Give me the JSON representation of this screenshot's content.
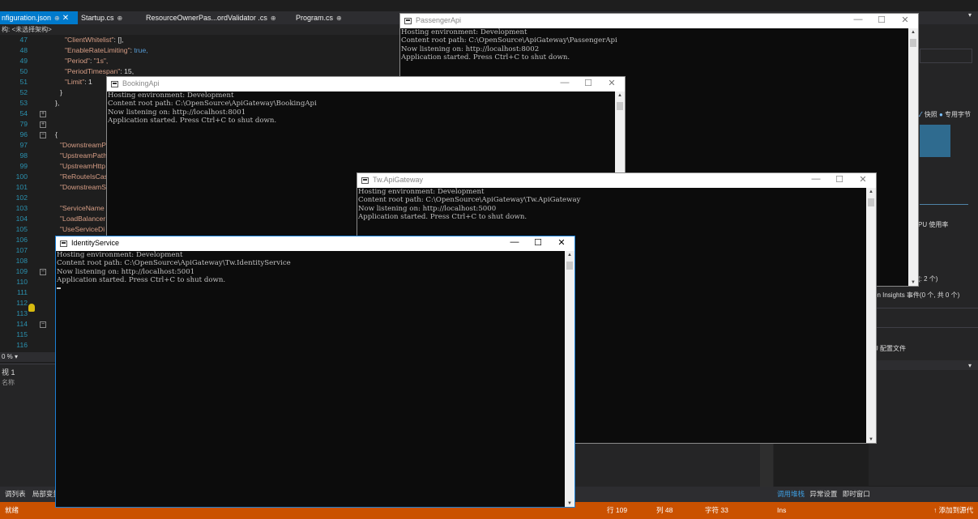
{
  "vs": {
    "tabs": [
      {
        "label": "nfiguration.json",
        "pin": "⊕",
        "close": "✕"
      },
      {
        "label": "Startup.cs",
        "pin": "⊕"
      },
      {
        "label": "ResourceOwnerPas...ordValidator .cs",
        "pin": "⊕"
      },
      {
        "label": "Program.cs",
        "pin": "⊕"
      }
    ],
    "tab_dropdown": "▾",
    "navbar": "构: <未选择架构>",
    "code_lines": [
      {
        "ln": "47",
        "key": "\"ClientWhitelist\"",
        "sep": ": ",
        "val": "[],",
        "vcls": "plain"
      },
      {
        "ln": "48",
        "key": "\"EnableRateLimiting\"",
        "sep": ": ",
        "val": "true,",
        "vcls": "v"
      },
      {
        "ln": "49",
        "key": "\"Period\"",
        "sep": ": ",
        "val": "\"1s\",",
        "vcls": "k"
      },
      {
        "ln": "50",
        "key": "\"PeriodTimespan\"",
        "sep": ": ",
        "val": "15,",
        "vcls": "plain"
      },
      {
        "ln": "51",
        "key": "\"Limit\"",
        "sep": ": ",
        "val": "1",
        "vcls": "plain"
      },
      {
        "ln": "52",
        "key": "",
        "sep": "",
        "val": "}",
        "vcls": "plain"
      },
      {
        "ln": "53",
        "key": "",
        "sep": "",
        "val": "},",
        "vcls": "plain"
      },
      {
        "ln": "54",
        "key": "",
        "sep": "",
        "val": "",
        "vcls": "plain"
      },
      {
        "ln": "79",
        "key": "",
        "sep": "",
        "val": "",
        "vcls": "plain"
      },
      {
        "ln": "96",
        "key": "",
        "sep": "",
        "val": "{",
        "vcls": "plain"
      },
      {
        "ln": "97",
        "key": "\"DownstreamP",
        "sep": "",
        "val": "",
        "vcls": "plain"
      },
      {
        "ln": "98",
        "key": "\"UpstreamPath",
        "sep": "",
        "val": "",
        "vcls": "plain"
      },
      {
        "ln": "99",
        "key": "\"UpstreamHttp",
        "sep": "",
        "val": "",
        "vcls": "plain"
      },
      {
        "ln": "100",
        "key": "\"ReRouteIsCas",
        "sep": "",
        "val": "",
        "vcls": "plain"
      },
      {
        "ln": "101",
        "key": "\"DownstreamS",
        "sep": "",
        "val": "",
        "vcls": "plain"
      },
      {
        "ln": "102",
        "key": "",
        "sep": "",
        "val": "",
        "vcls": "plain"
      },
      {
        "ln": "103",
        "key": "\"ServiceName",
        "sep": "",
        "val": "",
        "vcls": "plain"
      },
      {
        "ln": "104",
        "key": "\"LoadBalancer",
        "sep": "",
        "val": "",
        "vcls": "plain"
      },
      {
        "ln": "105",
        "key": "\"UseServiceDi",
        "sep": "",
        "val": "",
        "vcls": "plain"
      },
      {
        "ln": "106",
        "key": "",
        "sep": "",
        "val": "",
        "vcls": "plain"
      },
      {
        "ln": "107",
        "key": "",
        "sep": "",
        "val": "",
        "vcls": "plain"
      },
      {
        "ln": "108",
        "key": "",
        "sep": "",
        "val": "",
        "vcls": "plain"
      },
      {
        "ln": "109",
        "key": "",
        "sep": "",
        "val": "",
        "vcls": "plain"
      },
      {
        "ln": "110",
        "key": "",
        "sep": "",
        "val": "",
        "vcls": "plain"
      },
      {
        "ln": "111",
        "key": "",
        "sep": "",
        "val": "",
        "vcls": "plain"
      },
      {
        "ln": "112",
        "key": "",
        "sep": "",
        "val": "",
        "vcls": "plain"
      },
      {
        "ln": "113",
        "key": "",
        "sep": "",
        "val": "",
        "vcls": "plain"
      },
      {
        "ln": "114",
        "key": "",
        "sep": "",
        "val": "",
        "vcls": "plain"
      },
      {
        "ln": "115",
        "key": "",
        "sep": "",
        "val": "",
        "vcls": "plain"
      },
      {
        "ln": "116",
        "key": "",
        "sep": "",
        "val": "",
        "vcls": "plain"
      }
    ],
    "zoom": "0 %  ▾",
    "bottom_panel": {
      "title": "视 1",
      "name_col": "名称"
    },
    "bottom_tabs_left": [
      "调列表",
      "局部变量"
    ],
    "right_panel": {
      "legend_snapshot": "快照",
      "legend_private": "专用字节",
      "cpu_label": "PU 使用率",
      "count": "(: 2 个)",
      "insights": "on Insights 事件(0 个, 共 0 个)",
      "profile": "U 配置文件"
    },
    "bottom_tabs_right": [
      "调用堆栈",
      "异常设置",
      "即时窗口"
    ],
    "status": {
      "ready": "就绪",
      "line": "行 109",
      "col": "列 48",
      "ch": "字符 33",
      "ins": "Ins",
      "source_control": "↑ 添加到源代"
    }
  },
  "windows": {
    "passenger": {
      "title": "PassengerApi",
      "lines": [
        "Hosting environment: Development",
        "Content root path: C:\\OpenSource\\ApiGateway\\PassengerApi",
        "Now listening on: http://localhost:8002",
        "Application started. Press Ctrl+C to shut down."
      ]
    },
    "booking": {
      "title": "BookingApi",
      "lines": [
        "Hosting environment: Development",
        "Content root path: C:\\OpenSource\\ApiGateway\\BookingApi",
        "Now listening on: http://localhost:8001",
        "Application started. Press Ctrl+C to shut down."
      ]
    },
    "gateway": {
      "title": "Tw.ApiGateway",
      "lines": [
        "Hosting environment: Development",
        "Content root path: C:\\OpenSource\\ApiGateway\\Tw.ApiGateway",
        "Now listening on: http://localhost:5000",
        "Application started. Press Ctrl+C to shut down."
      ]
    },
    "identity": {
      "title": "IdentityService",
      "lines": [
        "Hosting environment: Development",
        "Content root path: C:\\OpenSource\\ApiGateway\\Tw.IdentityService",
        "Now listening on: http://localhost:5001",
        "Application started. Press Ctrl+C to shut down."
      ]
    },
    "controls": {
      "minimize": "—",
      "maximize": "☐",
      "close": "✕"
    }
  }
}
